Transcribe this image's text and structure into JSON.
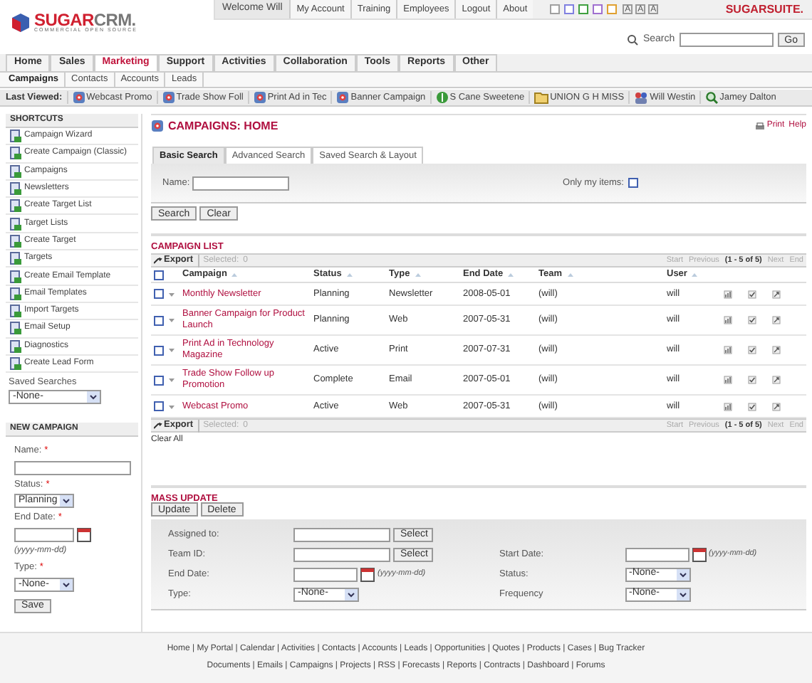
{
  "header": {
    "logo": {
      "primary": "SUGAR",
      "secondary": "CRM.",
      "tagline": "COMMERCIAL OPEN SOURCE"
    },
    "welcome": "Welcome Will",
    "links": [
      "My Account",
      "Training",
      "Employees",
      "Logout",
      "About"
    ],
    "themes": [
      {
        "color": "#a0a0a0"
      },
      {
        "color": "#8080e0"
      },
      {
        "color": "#40a040"
      },
      {
        "color": "#a070d0"
      },
      {
        "color": "#e0a030"
      }
    ],
    "font_sizes": [
      {
        "label": "A"
      },
      {
        "label": "A"
      },
      {
        "label": "A"
      }
    ],
    "brand": "SUGARSUITE.",
    "search": {
      "label": "Search",
      "button": "Go"
    }
  },
  "tabs": [
    {
      "label": "Home",
      "selected": false
    },
    {
      "label": "Sales",
      "selected": false
    },
    {
      "label": "Marketing",
      "selected": true
    },
    {
      "label": "Support",
      "selected": false
    },
    {
      "label": "Activities",
      "selected": false
    },
    {
      "label": "Collaboration",
      "selected": false
    },
    {
      "label": "Tools",
      "selected": false
    },
    {
      "label": "Reports",
      "selected": false
    },
    {
      "label": "Other",
      "selected": false
    }
  ],
  "subtabs": [
    {
      "label": "Campaigns",
      "selected": true
    },
    {
      "label": "Contacts",
      "selected": false
    },
    {
      "label": "Accounts",
      "selected": false
    },
    {
      "label": "Leads",
      "selected": false
    }
  ],
  "last_viewed": {
    "label": "Last Viewed:",
    "items": [
      {
        "kind": "campaign",
        "label": "Webcast Promo"
      },
      {
        "kind": "campaign",
        "label": "Trade Show Foll"
      },
      {
        "kind": "campaign",
        "label": "Print Ad in Tec"
      },
      {
        "kind": "campaign",
        "label": "Banner Campaign"
      },
      {
        "kind": "opportunity",
        "label": "S Cane Sweetene"
      },
      {
        "kind": "account",
        "label": "UNION G H MISS"
      },
      {
        "kind": "contact",
        "label": "Will Westin"
      },
      {
        "kind": "lead",
        "label": "Jamey Dalton"
      }
    ]
  },
  "sidebar": {
    "shortcuts": {
      "title": "SHORTCUTS",
      "items": [
        "Campaign Wizard",
        "Create Campaign (Classic)",
        "Campaigns",
        "Newsletters",
        "Create Target List",
        "Target Lists",
        "Create Target",
        "Targets",
        "Create Email Template",
        "Email Templates",
        "Import Targets",
        "Email Setup",
        "Diagnostics",
        "Create Lead Form"
      ]
    },
    "saved_searches": {
      "label": "Saved Searches",
      "value": "-None-"
    },
    "new_campaign": {
      "title": "NEW CAMPAIGN",
      "name_label": "Name:",
      "status_label": "Status:",
      "status_value": "Planning",
      "end_date_label": "End Date:",
      "date_hint": "(yyyy-mm-dd)",
      "type_label": "Type:",
      "type_value": "-None-",
      "required_mark": "*",
      "save": "Save"
    }
  },
  "main": {
    "title": "CAMPAIGNS: HOME",
    "print": "Print",
    "help": "Help",
    "search_tabs": [
      {
        "label": "Basic Search",
        "selected": true
      },
      {
        "label": "Advanced Search",
        "selected": false
      },
      {
        "label": "Saved Search & Layout",
        "selected": false
      }
    ],
    "search_form": {
      "name_label": "Name:",
      "only_mine_label": "Only my items:",
      "only_mine_checked": false,
      "buttons": [
        "Search",
        "Clear"
      ]
    },
    "list": {
      "title": "CAMPAIGN LIST",
      "toolbars": [
        {
          "export": "Export",
          "selected_label": "Selected:",
          "selected_count": "0",
          "pagination": [
            {
              "label": "Start",
              "disabled": true
            },
            {
              "label": "Previous",
              "disabled": true
            },
            {
              "label": "(1 - 5 of 5)",
              "disabled": false
            },
            {
              "label": "Next",
              "disabled": true
            },
            {
              "label": "End",
              "disabled": true
            }
          ]
        },
        {
          "export": "Export",
          "selected_label": "Selected:",
          "selected_count": "0",
          "pagination": [
            {
              "label": "Start",
              "disabled": true
            },
            {
              "label": "Previous",
              "disabled": true
            },
            {
              "label": "(1 - 5 of 5)",
              "disabled": false
            },
            {
              "label": "Next",
              "disabled": true
            },
            {
              "label": "End",
              "disabled": true
            }
          ]
        }
      ],
      "all_checked": false,
      "columns": [
        "Campaign",
        "Status",
        "Type",
        "End Date",
        "Team",
        "User"
      ],
      "rows": [
        {
          "checked": false,
          "cells": [
            "Monthly Newsletter",
            "Planning",
            "Newsletter",
            "2008-05-01",
            "(will)",
            "will"
          ]
        },
        {
          "checked": false,
          "cells": [
            "Banner Campaign for Product Launch",
            "Planning",
            "Web",
            "2007-05-31",
            "(will)",
            "will"
          ]
        },
        {
          "checked": false,
          "cells": [
            "Print Ad in Technology Magazine",
            "Active",
            "Print",
            "2007-07-31",
            "(will)",
            "will"
          ]
        },
        {
          "checked": false,
          "cells": [
            "Trade Show Follow up Promotion",
            "Complete",
            "Email",
            "2007-05-01",
            "(will)",
            "will"
          ]
        },
        {
          "checked": false,
          "cells": [
            "Webcast Promo",
            "Active",
            "Web",
            "2007-05-31",
            "(will)",
            "will"
          ]
        }
      ],
      "clear_all": "Clear All"
    },
    "mass_update": {
      "title": "MASS UPDATE",
      "buttons": [
        "Update",
        "Delete"
      ],
      "rows": [
        {
          "left": {
            "kind": "lookup",
            "label": "Assigned to:",
            "button": "Select"
          }
        },
        {
          "left": {
            "kind": "lookup",
            "label": "Team ID:",
            "button": "Select"
          },
          "right": {
            "kind": "date",
            "label": "Start Date:",
            "hint": "(yyyy-mm-dd)"
          }
        },
        {
          "left": {
            "kind": "date",
            "label": "End Date:",
            "hint": "(yyyy-mm-dd)"
          },
          "right": {
            "kind": "select",
            "label": "Status:",
            "value": "-None-"
          }
        },
        {
          "left": {
            "kind": "select",
            "label": "Type:",
            "value": "-None-"
          },
          "right": {
            "kind": "select",
            "label": "Frequency",
            "value": "-None-"
          }
        }
      ]
    }
  },
  "footer": {
    "lines": [
      "Home | My Portal | Calendar | Activities | Contacts | Accounts | Leads | Opportunities | Quotes | Products | Cases | Bug Tracker",
      "Documents | Emails | Campaigns | Projects | RSS | Forecasts | Reports | Contracts | Dashboard | Forums"
    ]
  }
}
